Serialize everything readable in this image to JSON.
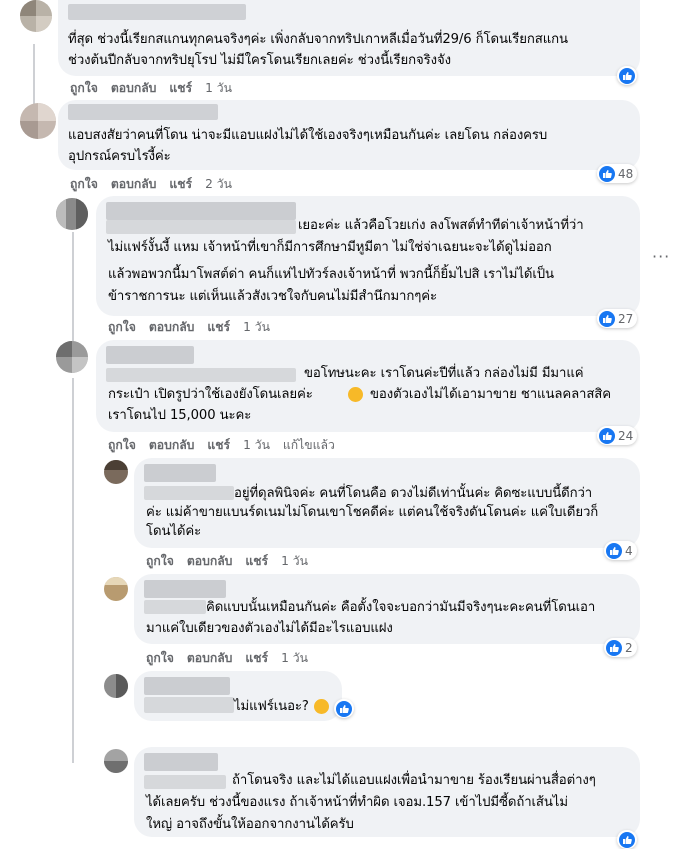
{
  "comments": [
    {
      "id": "c1",
      "lines": [
        "ที่สุด ช่วงนี้เรียกสแกนทุกคนจริงๆค่ะ เพิ่งกลับจากทริปเกาหลีเมื่อวันที่29/6 ก็โดนเรียกสแกน",
        "ช่วงต้นปีกลับจากทริปยุโรป ไม่มีใครโดนเรียกเลยค่ะ ช่วงนี้เรียกจริงจัง"
      ],
      "like": "ถูกใจ",
      "reply": "ตอบกลับ",
      "share": "แชร์",
      "time": "1 วัน",
      "reaction_count": ""
    },
    {
      "id": "c2",
      "lines": [
        "แอบสงสัยว่าคนที่โดน น่าจะมีแอบแฝงไม่ได้ใช้เองจริงๆเหมือนกันค่ะ เลยโดน กล่องครบ",
        "อุปกรณ์ครบไรงี้ค่ะ"
      ],
      "like": "ถูกใจ",
      "reply": "ตอบกลับ",
      "share": "แชร์",
      "time": "2 วัน",
      "reaction_count": "48"
    },
    {
      "id": "c3",
      "lines": [
        "เยอะค่ะ แล้วคือโวยเก่ง ลงโพสต์ทำทีด่าเจ้าหน้าที่ว่า",
        "ไม่แฟร์งั้นงี้ แหม เจ้าหน้าที่เขาก็มีการศึกษามีหูมีตา ไม่ใช่จ่าเฉยนะจะได้ดูไม่ออก",
        "แล้วพอพวกนี้มาโพสต์ด่า คนก็แห่ไปทัวร์ลงเจ้าหน้าที่ พวกนี้ก็ยิ้มไปสิ เราไม่ได้เป็น",
        "ข้าราชการนะ แต่เห็นแล้วสังเวชใจกับคนไม่มีสำนึกมากๆค่ะ"
      ],
      "like": "ถูกใจ",
      "reply": "ตอบกลับ",
      "share": "แชร์",
      "time": "1 วัน",
      "reaction_count": "27"
    },
    {
      "id": "c4",
      "lines": [
        "ขอโทษนะคะ เราโดนค่ะปีที่แล้ว กล่องไม่มี มีมาแค่",
        "กระเป๋า เปิดรูปว่าใช้เองยังโดนเลยค่ะ",
        "ของตัวเองไม่ได้เอามาขาย ชาแนลคลาสสิค",
        "เราโดนไป 15,000 นะคะ"
      ],
      "like": "ถูกใจ",
      "reply": "ตอบกลับ",
      "share": "แชร์",
      "time": "1 วัน",
      "edited": "แก้ไขแล้ว",
      "reaction_count": "24"
    },
    {
      "id": "c5",
      "lines": [
        "อยู่ที่ดุลพินิจค่ะ คนที่โดนคือ ดวงไม่ดีเท่านั้นค่ะ คิดซะแบบนี้ดีกว่า",
        "ค่ะ แม่ค้าขายแบนร์ดเนมไม่โดนเขาโชคดีค่ะ แต่คนใช้จริงดันโดนค่ะ แค่ใบเดียวก็",
        "โดนได้ค่ะ"
      ],
      "like": "ถูกใจ",
      "reply": "ตอบกลับ",
      "share": "แชร์",
      "time": "1 วัน",
      "reaction_count": "4"
    },
    {
      "id": "c6",
      "lines": [
        "คิดแบบนั้นเหมือนกันค่ะ คือตั้งใจจะบอกว่ามันมีจริงๆนะคะคนที่โดนเอา",
        "มาแค่ใบเดียวของตัวเองไม่ได้มีอะไรแอบแฝง"
      ],
      "like": "ถูกใจ",
      "reply": "ตอบกลับ",
      "share": "แชร์",
      "time": "1 วัน",
      "reaction_count": "2"
    },
    {
      "id": "c7",
      "lines": [
        "ไม่แฟร์เนอะ?"
      ],
      "reaction_count": ""
    },
    {
      "id": "c8",
      "lines": [
        "ถ้าโดนจริง และไม่ได้แอบแฝงเพื่อนำมาขาย ร้องเรียนผ่านสื่อต่างๆ",
        "ได้เลยครับ ช่วงนี้ของแรง ถ้าเจ้าหน้าที่ทำผิด เจอม.157 เข้าไปมีซี้ดถ้าเส้นไม่",
        "ใหญ่ อาจถึงขั้นให้ออกจากงานได้ครับ"
      ],
      "reaction_count": ""
    }
  ],
  "icons": {
    "like": "like-thumb-icon",
    "more": "more-options-icon",
    "emoji_crying": "crying-face-emoji",
    "emoji_sweat": "sweat-smile-emoji"
  },
  "colors": {
    "bubble": "#f0f2f5",
    "like_blue": "#1877f2",
    "meta_gray": "#65676b",
    "text": "#050505"
  }
}
